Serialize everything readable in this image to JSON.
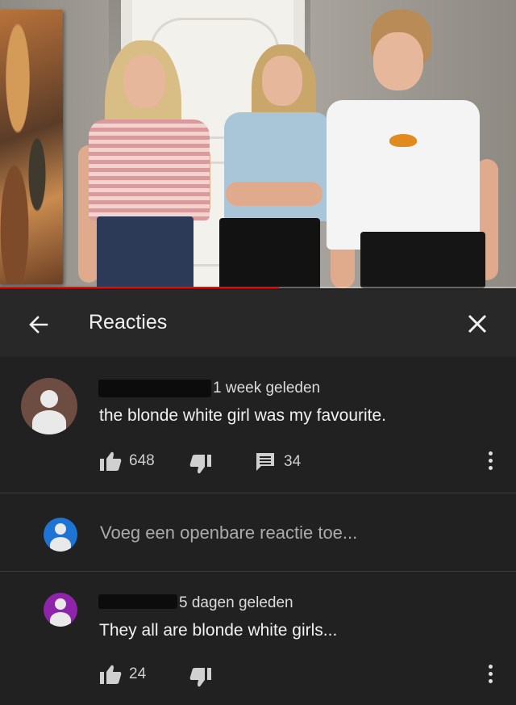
{
  "video": {
    "progress_percent": 54
  },
  "header": {
    "title": "Reacties",
    "back_icon": "arrow-left-icon",
    "close_icon": "close-icon"
  },
  "comments": [
    {
      "time": "1 week geleden",
      "text": "the blonde white girl was my favourite.",
      "likes": "648",
      "replies": "34",
      "avatar_color": "#6d4c41"
    },
    {
      "time": "5 dagen geleden",
      "text": "They all are blonde white girls...",
      "likes": "24",
      "avatar_color": "#8e24aa"
    }
  ],
  "add_comment": {
    "placeholder": "Voeg een openbare reactie toe...",
    "avatar_color": "#1e74d4"
  },
  "colors": {
    "background": "#212121",
    "header": "#282828",
    "progress": "#ff0000"
  }
}
